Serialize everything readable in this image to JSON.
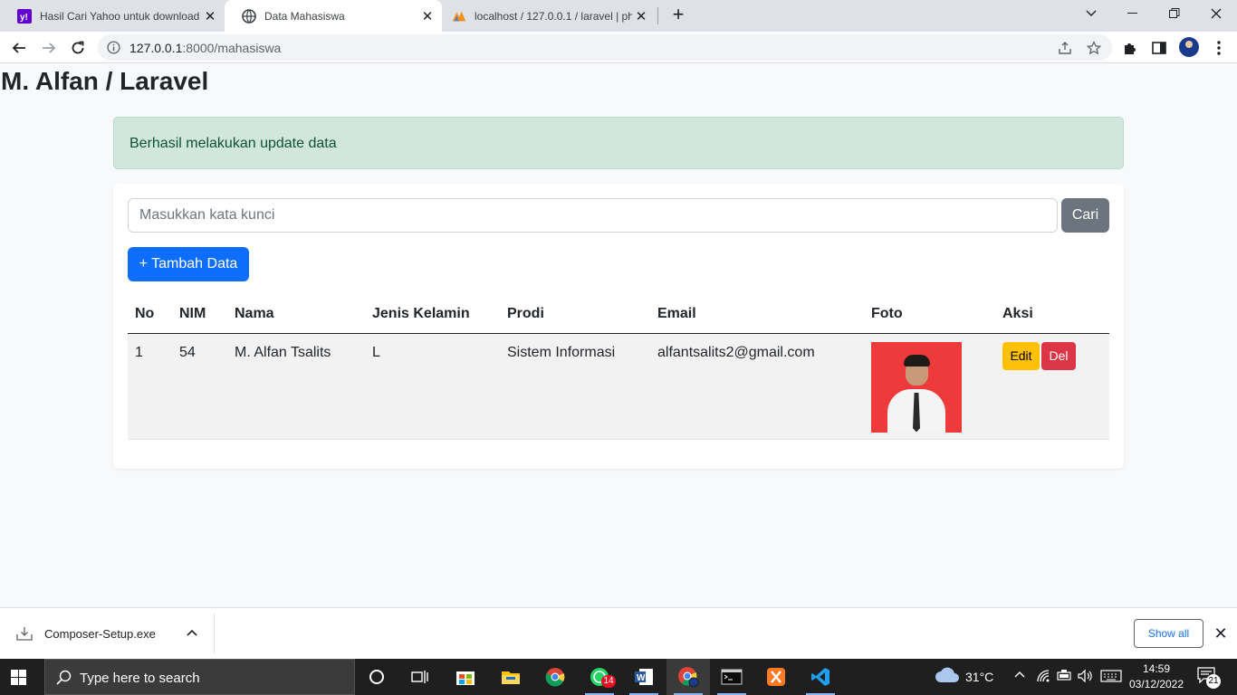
{
  "browser": {
    "tabs": [
      {
        "title": "Hasil Cari Yahoo untuk download",
        "icon": "yahoo-icon"
      },
      {
        "title": "Data Mahasiswa",
        "icon": "globe-icon"
      },
      {
        "title": "localhost / 127.0.0.1 / laravel | ph",
        "icon": "phpmyadmin-icon"
      }
    ],
    "url_host": "127.0.0.1",
    "url_path": ":8000/mahasiswa"
  },
  "page": {
    "title": "M. Alfan / Laravel",
    "alert": "Berhasil melakukan update data",
    "search_placeholder": "Masukkan kata kunci",
    "search_button": "Cari",
    "add_button": "+ Tambah Data"
  },
  "table": {
    "headers": [
      "No",
      "NIM",
      "Nama",
      "Jenis Kelamin",
      "Prodi",
      "Email",
      "Foto",
      "Aksi"
    ],
    "rows": [
      {
        "no": "1",
        "nim": "54",
        "nama": "M. Alfan Tsalits",
        "jk": "L",
        "prodi": "Sistem Informasi",
        "email": "alfantsalits2@gmail.com",
        "edit": "Edit",
        "del": "Del"
      }
    ]
  },
  "downloads": {
    "file": "Composer-Setup.exe",
    "show_all": "Show all"
  },
  "taskbar": {
    "search_placeholder": "Type here to search",
    "whatsapp_badge": "14",
    "temperature": "31°C",
    "time": "14:59",
    "date": "03/12/2022",
    "notifications": "21"
  },
  "colors": {
    "primary": "#0d6efd",
    "secondary": "#6c757d",
    "warning": "#ffc107",
    "danger": "#dc3545",
    "alert_bg": "#d1e7dd",
    "alert_text": "#0f5132"
  }
}
